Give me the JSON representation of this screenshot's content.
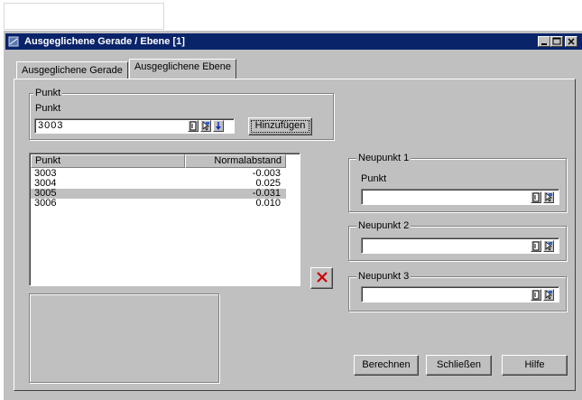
{
  "window": {
    "title": "Ausgeglichene Gerade / Ebene [1]",
    "caption_buttons": {
      "minimize": "_",
      "maximize": "□",
      "close": "×"
    }
  },
  "tabs": [
    {
      "label": "Ausgeglichene Gerade",
      "active": false
    },
    {
      "label": "Ausgeglichene Ebene",
      "active": true
    }
  ],
  "punkt_group": {
    "legend": "Punkt",
    "field_label": "Punkt",
    "value": "3003",
    "add_button": "Hinzufügen"
  },
  "table": {
    "columns": [
      "Punkt",
      "Normalabstand"
    ],
    "rows": [
      {
        "punkt": "3003",
        "normalabstand": "-0.003",
        "selected": false
      },
      {
        "punkt": "3004",
        "normalabstand": "0.025",
        "selected": false
      },
      {
        "punkt": "3005",
        "normalabstand": "-0.031",
        "selected": true
      },
      {
        "punkt": "3006",
        "normalabstand": "0.010",
        "selected": false
      }
    ]
  },
  "neupunkt1": {
    "legend": "Neupunkt 1",
    "field_label": "Punkt",
    "value": ""
  },
  "neupunkt2": {
    "legend": "Neupunkt 2",
    "value": ""
  },
  "neupunkt3": {
    "legend": "Neupunkt 3",
    "value": ""
  },
  "buttons": {
    "berechnen": "Berechnen",
    "schliessen": "Schließen",
    "hilfe": "Hilfe"
  },
  "icons": {
    "delete": "red-x-delete-icon"
  },
  "colors": {
    "titlebar": "#0a246a",
    "face": "#c0c0c0",
    "delete": "#cc0000"
  }
}
